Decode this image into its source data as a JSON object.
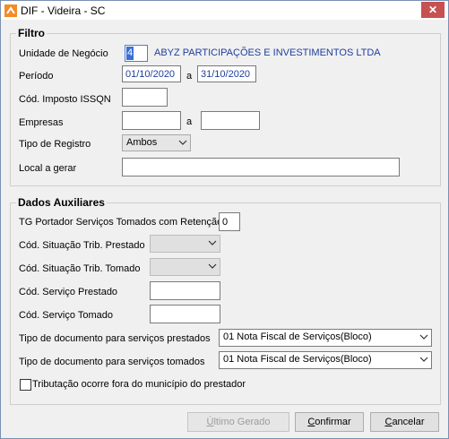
{
  "window": {
    "title": "DIF - Videira - SC",
    "close_label": "✕"
  },
  "filtro": {
    "title": "Filtro",
    "unidade_label": "Unidade de Negócio",
    "unidade_value": "4",
    "unidade_nome": "ABYZ PARTICIPAÇÕES E INVESTIMENTOS LTDA",
    "periodo_label": "Período",
    "periodo_inicio": "01/10/2020",
    "periodo_sep": "a",
    "periodo_fim": "31/10/2020",
    "imposto_label": "Cód. Imposto ISSQN",
    "imposto_value": "",
    "empresas_label": "Empresas",
    "empresas_inicio": "",
    "empresas_sep": "a",
    "empresas_fim": "",
    "tipo_registro_label": "Tipo de Registro",
    "tipo_registro_value": "Ambos",
    "local_label": "Local a gerar",
    "local_value": ""
  },
  "auxiliares": {
    "title": "Dados Auxiliares",
    "tg_label": "TG Portador Serviços Tomados com Retenção",
    "tg_value": "0",
    "sit_prestado_label": "Cód. Situação Trib. Prestado",
    "sit_prestado_value": "",
    "sit_tomado_label": "Cód. Situação Trib. Tomado",
    "sit_tomado_value": "",
    "serv_prestado_label": "Cód. Serviço Prestado",
    "serv_prestado_value": "",
    "serv_tomado_label": "Cód. Serviço Tomado",
    "serv_tomado_value": "",
    "doc_prestados_label": "Tipo de documento para serviços prestados",
    "doc_prestados_value": "01 Nota Fiscal de Serviços(Bloco)",
    "doc_tomados_label": "Tipo de documento para serviços tomados",
    "doc_tomados_value": "01 Nota Fiscal de Serviços(Bloco)",
    "fora_municipio_label": "Tributação ocorre fora do município do prestador",
    "fora_municipio_checked": false
  },
  "buttons": {
    "ultimo_first": "Ú",
    "ultimo_rest": "ltimo Gerado",
    "confirmar_first": "C",
    "confirmar_rest": "onfirmar",
    "cancelar_first": "C",
    "cancelar_rest": "ancelar"
  },
  "colors": {
    "accent": "#1f3e9e",
    "close": "#c75050",
    "selection": "#3b6fd1"
  }
}
